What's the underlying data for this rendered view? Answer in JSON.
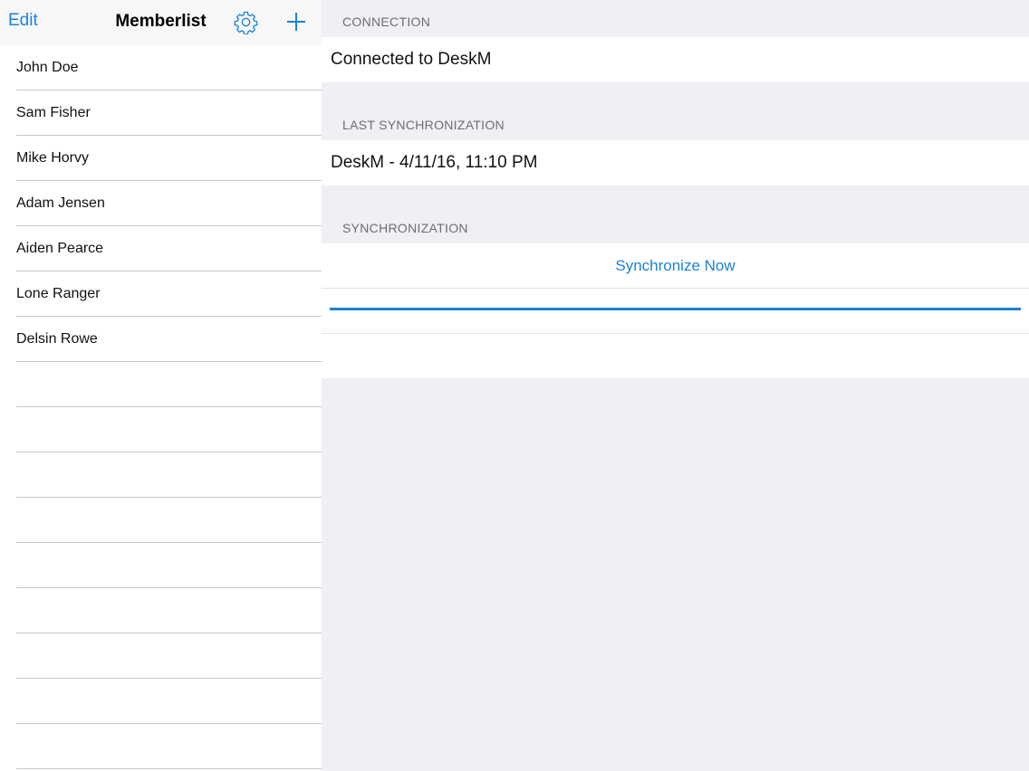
{
  "nav": {
    "edit_label": "Edit",
    "title": "Memberlist",
    "settings_icon": "gear-icon",
    "add_icon": "plus-icon"
  },
  "members": [
    {
      "name": "John Doe"
    },
    {
      "name": "Sam Fisher"
    },
    {
      "name": "Mike Horvy"
    },
    {
      "name": "Adam Jensen"
    },
    {
      "name": "Aiden Pearce"
    },
    {
      "name": "Lone Ranger"
    },
    {
      "name": "Delsin Rowe"
    }
  ],
  "detail": {
    "connection_header": "CONNECTION",
    "connection_status": "Connected to DeskM",
    "last_sync_header": "LAST SYNCHRONIZATION",
    "last_sync_value": "DeskM - 4/11/16, 11:10 PM",
    "sync_header": "SYNCHRONIZATION",
    "sync_button": "Synchronize Now",
    "progress": 1.0
  },
  "colors": {
    "accent": "#1a82d8",
    "background": "#efeff4",
    "separator": "#c8c7cc"
  }
}
